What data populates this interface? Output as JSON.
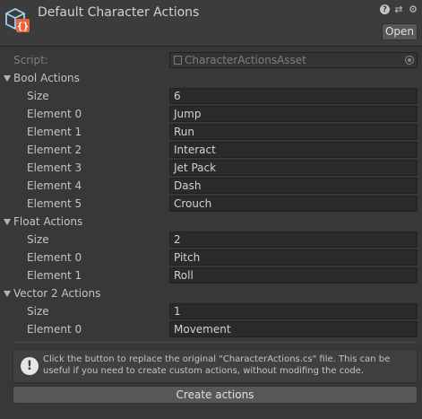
{
  "header": {
    "title": "Default Character Actions",
    "open_label": "Open",
    "icons": [
      "scriptable-asset-icon",
      "help-icon",
      "preset-icon",
      "settings-icon"
    ]
  },
  "script": {
    "label": "Script:",
    "value": "CharacterActionsAsset"
  },
  "bool_actions": {
    "label": "Bool Actions",
    "size_label": "Size",
    "size": "6",
    "elements": [
      {
        "label": "Element 0",
        "value": "Jump"
      },
      {
        "label": "Element 1",
        "value": "Run"
      },
      {
        "label": "Element 2",
        "value": "Interact"
      },
      {
        "label": "Element 3",
        "value": "Jet Pack"
      },
      {
        "label": "Element 4",
        "value": "Dash"
      },
      {
        "label": "Element 5",
        "value": "Crouch"
      }
    ]
  },
  "float_actions": {
    "label": "Float Actions",
    "size_label": "Size",
    "size": "2",
    "elements": [
      {
        "label": "Element 0",
        "value": "Pitch"
      },
      {
        "label": "Element 1",
        "value": "Roll"
      }
    ]
  },
  "vector2_actions": {
    "label": "Vector 2 Actions",
    "size_label": "Size",
    "size": "1",
    "elements": [
      {
        "label": "Element 0",
        "value": "Movement"
      }
    ]
  },
  "help": {
    "text": "Click the button to replace the original \"CharacterActions.cs\" file. This can be useful if you need to create custom actions, without modifing the code."
  },
  "create_button": "Create actions"
}
